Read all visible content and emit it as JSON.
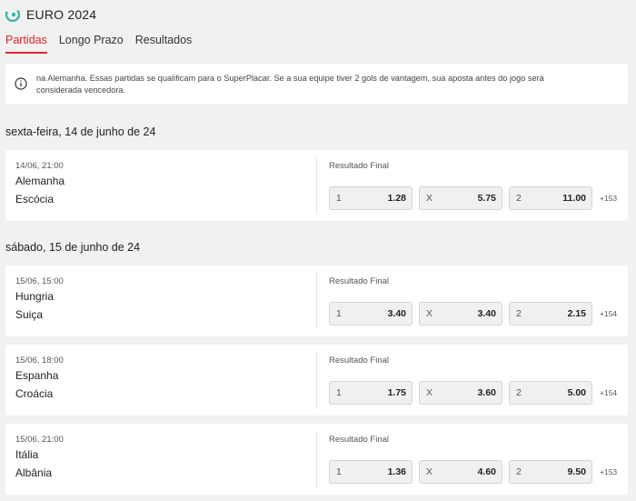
{
  "header": {
    "title": "EURO 2024",
    "tabs": [
      {
        "label": "Partidas",
        "active": true
      },
      {
        "label": "Longo Prazo",
        "active": false
      },
      {
        "label": "Resultados",
        "active": false
      }
    ]
  },
  "info": {
    "text": "na Alemanha. Essas partidas se qualificam para o SuperPlacar. Se a sua equipe tiver 2 gols de vantagem, sua aposta antes do jogo será considerada vencedora."
  },
  "colors": {
    "accent": "#e0262f",
    "logo": "#3cb8a8"
  },
  "days": [
    {
      "heading": "sexta-feira, 14 de junho de 24",
      "matches": [
        {
          "time": "14/06, 21:00",
          "home": "Alemanha",
          "away": "Escócia",
          "market": "Resultado Final",
          "odds": [
            {
              "label": "1",
              "value": "1.28"
            },
            {
              "label": "X",
              "value": "5.75"
            },
            {
              "label": "2",
              "value": "11.00"
            }
          ],
          "more": "+153"
        }
      ]
    },
    {
      "heading": "sábado, 15 de junho de 24",
      "matches": [
        {
          "time": "15/06, 15:00",
          "home": "Hungria",
          "away": "Suiça",
          "market": "Resultado Final",
          "odds": [
            {
              "label": "1",
              "value": "3.40"
            },
            {
              "label": "X",
              "value": "3.40"
            },
            {
              "label": "2",
              "value": "2.15"
            }
          ],
          "more": "+154"
        },
        {
          "time": "15/06, 18:00",
          "home": "Espanha",
          "away": "Croácia",
          "market": "Resultado Final",
          "odds": [
            {
              "label": "1",
              "value": "1.75"
            },
            {
              "label": "X",
              "value": "3.60"
            },
            {
              "label": "2",
              "value": "5.00"
            }
          ],
          "more": "+154"
        },
        {
          "time": "15/06, 21:00",
          "home": "Itália",
          "away": "Albânia",
          "market": "Resultado Final",
          "odds": [
            {
              "label": "1",
              "value": "1.36"
            },
            {
              "label": "X",
              "value": "4.60"
            },
            {
              "label": "2",
              "value": "9.50"
            }
          ],
          "more": "+153"
        }
      ]
    }
  ]
}
